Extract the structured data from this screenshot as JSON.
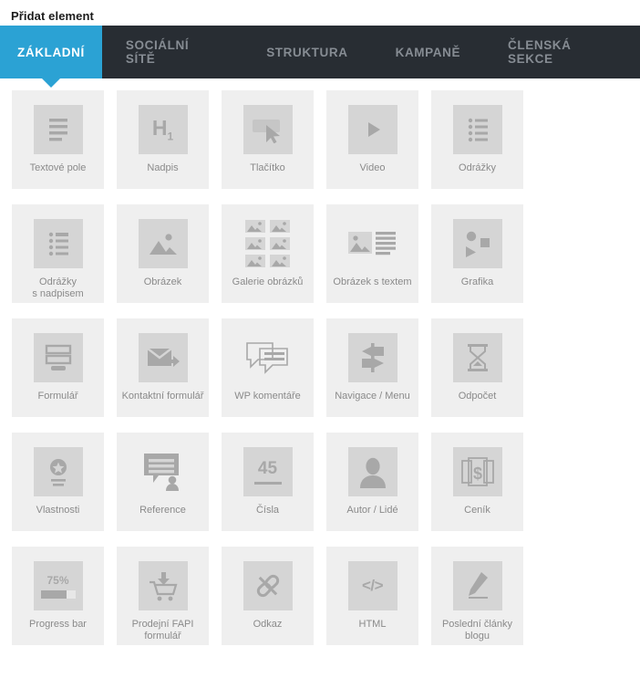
{
  "header": {
    "title": "Přidat element"
  },
  "tabs": [
    {
      "label": "ZÁKLADNÍ",
      "active": true
    },
    {
      "label": "SOCIÁLNÍ SÍTĚ",
      "active": false
    },
    {
      "label": "STRUKTURA",
      "active": false
    },
    {
      "label": "KAMPANĚ",
      "active": false
    },
    {
      "label": "ČLENSKÁ SEKCE",
      "active": false
    }
  ],
  "colors": {
    "accent": "#2ba2d4",
    "tabbar_bg": "#282d33",
    "tab_inactive_text": "#868c93",
    "tile_bg": "#efefef",
    "icon_box_bg": "#d5d5d5",
    "icon_glyph": "#a8a8a8",
    "label_text": "#8a8a8a",
    "title_text": "#1c1c1c"
  },
  "elements": [
    {
      "label": "Textové pole",
      "icon": "text-lines-icon"
    },
    {
      "label": "Nadpis",
      "icon": "heading-h1-icon",
      "glyph_text": "H",
      "glyph_sub": "1"
    },
    {
      "label": "Tlačítko",
      "icon": "button-cursor-icon"
    },
    {
      "label": "Video",
      "icon": "video-play-icon"
    },
    {
      "label": "Odrážky",
      "icon": "bullet-list-icon"
    },
    {
      "label": "Odrážky\ns nadpisem",
      "icon": "bullet-list-heading-icon"
    },
    {
      "label": "Obrázek",
      "icon": "image-icon"
    },
    {
      "label": "Galerie obrázků",
      "icon": "image-gallery-icon"
    },
    {
      "label": "Obrázek s textem",
      "icon": "image-with-text-icon"
    },
    {
      "label": "Grafika",
      "icon": "shapes-graphic-icon"
    },
    {
      "label": "Formulář",
      "icon": "form-icon"
    },
    {
      "label": "Kontaktní formulář",
      "icon": "contact-envelope-icon"
    },
    {
      "label": "WP komentáře",
      "icon": "comments-outline-icon"
    },
    {
      "label": "Navigace / Menu",
      "icon": "signpost-navigation-icon"
    },
    {
      "label": "Odpočet",
      "icon": "hourglass-countdown-icon"
    },
    {
      "label": "Vlastnosti",
      "icon": "star-badge-icon"
    },
    {
      "label": "Reference",
      "icon": "testimonial-quote-icon"
    },
    {
      "label": "Čísla",
      "icon": "numbers-icon",
      "glyph_text": "45"
    },
    {
      "label": "Autor / Lidé",
      "icon": "person-avatar-icon"
    },
    {
      "label": "Ceník",
      "icon": "pricing-money-icon"
    },
    {
      "label": "Progress bar",
      "icon": "progress-bar-icon",
      "glyph_text": "75%"
    },
    {
      "label": "Prodejní FAPI\nformulář",
      "icon": "shopping-cart-icon"
    },
    {
      "label": "Odkaz",
      "icon": "link-chain-icon"
    },
    {
      "label": "HTML",
      "icon": "html-code-icon",
      "glyph_text": "</>"
    },
    {
      "label": "Poslední články\nblogu",
      "icon": "pencil-blog-icon"
    }
  ]
}
